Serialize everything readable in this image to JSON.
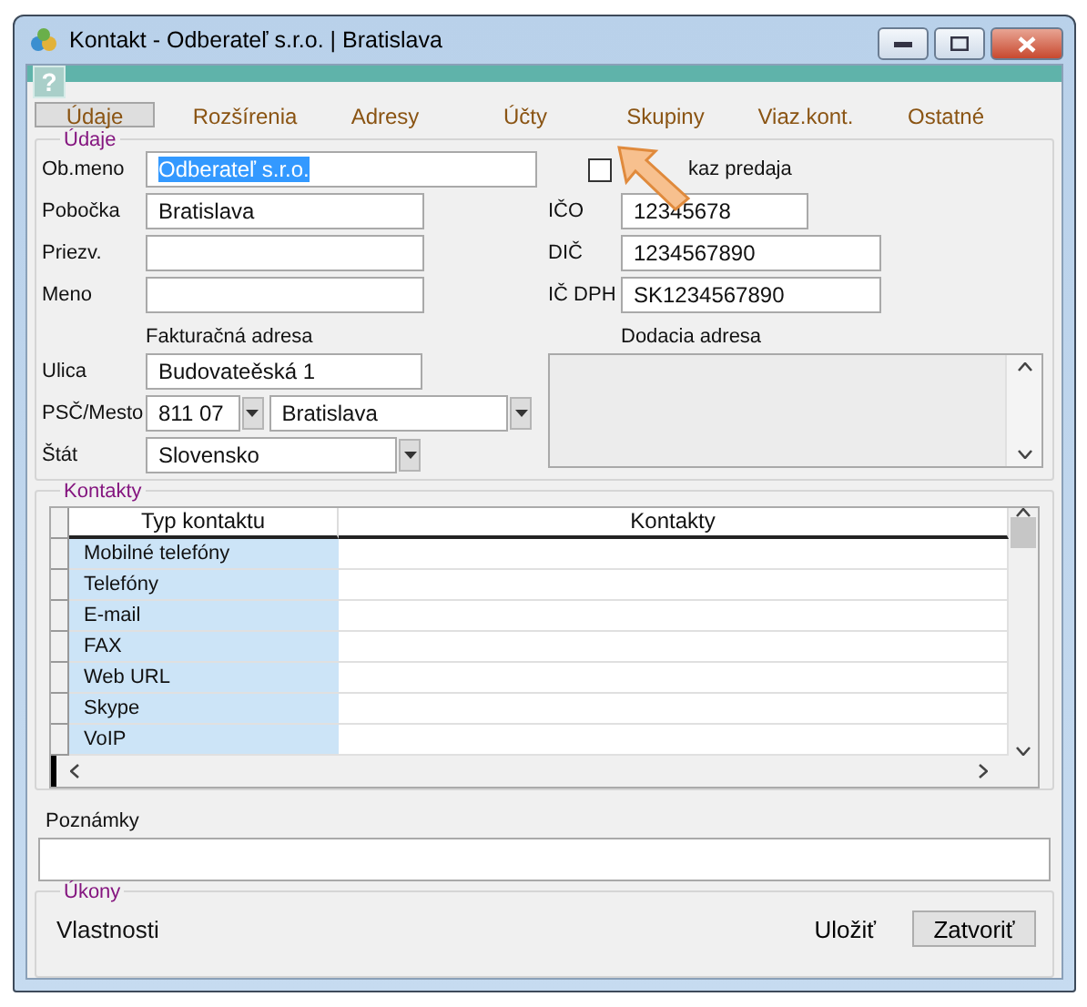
{
  "window": {
    "title": "Kontakt - Odberateľ s.r.o. | Bratislava",
    "help": "?"
  },
  "tabs": [
    {
      "label": "Údaje",
      "selected": true
    },
    {
      "label": "Rozšírenia",
      "selected": false
    },
    {
      "label": "Adresy",
      "selected": false
    },
    {
      "label": "Účty",
      "selected": false
    },
    {
      "label": "Skupiny",
      "selected": false
    },
    {
      "label": "Viaz.kont.",
      "selected": false
    },
    {
      "label": "Ostatné",
      "selected": false
    }
  ],
  "details": {
    "legend": "Údaje",
    "obmeno": {
      "label": "Ob.meno",
      "value": "Odberateľ s.r.o.",
      "text_selected": true
    },
    "left_fields": [
      {
        "label": "Pobočka",
        "value": "Bratislava"
      },
      {
        "label": "Priezv."
      },
      {
        "label": "Meno"
      }
    ],
    "sales_report": {
      "label": "kaz predaja",
      "checked": false
    },
    "right_fields": [
      {
        "label": "IČO",
        "value": "12345678",
        "wide": false
      },
      {
        "label": "DIČ",
        "value": "1234567890",
        "wide": true
      },
      {
        "label": "IČ DPH",
        "value": "SK1234567890",
        "wide": true
      }
    ],
    "billing_heading": "Fakturačná adresa",
    "delivery_heading": "Dodacia adresa",
    "street": {
      "label": "Ulica",
      "value": "Budovateěská 1"
    },
    "zip_city": {
      "label": "PSČ/Mesto",
      "zip": "811 07",
      "city": "Bratislava"
    },
    "country": {
      "label": "Štát",
      "value": "Slovensko"
    }
  },
  "contacts": {
    "legend": "Kontakty",
    "columns": [
      "Typ kontaktu",
      "Kontakty"
    ],
    "rows": [
      {
        "type": "Mobilné telefóny"
      },
      {
        "type": "Telefóny"
      },
      {
        "type": "E-mail"
      },
      {
        "type": "FAX"
      },
      {
        "type": "Web URL"
      },
      {
        "type": "Skype"
      },
      {
        "type": "VoIP"
      }
    ]
  },
  "notes": {
    "label": "Poznámky"
  },
  "actions": {
    "legend": "Úkony",
    "properties": "Vlastnosti",
    "save": "Uložiť",
    "close": "Zatvoriť"
  }
}
